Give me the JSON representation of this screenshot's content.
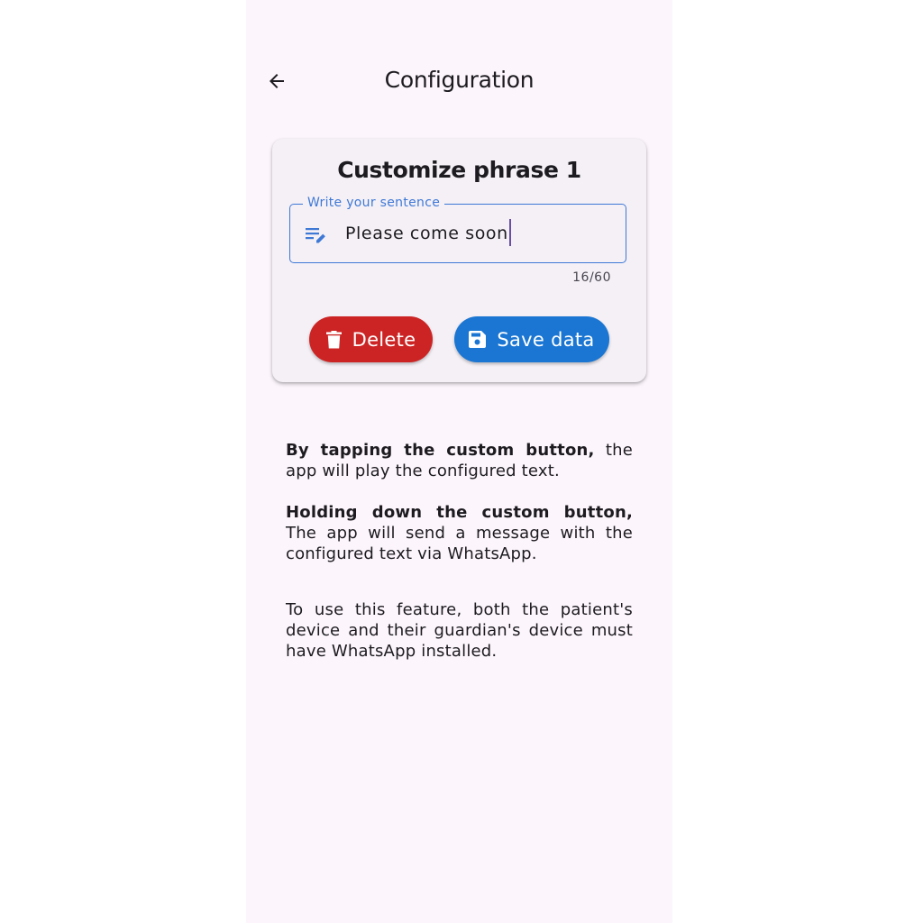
{
  "app_bar": {
    "title": "Configuration",
    "back_icon": "arrow-left-icon"
  },
  "card": {
    "title": "Customize phrase 1",
    "field": {
      "label": "Write your sentence",
      "icon": "edit-note-icon",
      "value": "Please come soon",
      "counter": "16/60"
    },
    "buttons": {
      "delete_label": "Delete",
      "delete_icon": "trash-icon",
      "delete_color": "#cc2424",
      "save_label": "Save data",
      "save_icon": "save-icon",
      "save_color": "#1a76d2"
    }
  },
  "info": {
    "tap_bold": "By tapping the custom button,",
    "tap_text": " the app will play the configured text.",
    "hold_bold": "Holding down the custom button,",
    "hold_text": " The app will send a message with the configured text via WhatsApp.",
    "requirement": "To use this feature, both the patient's device and their guardian's device must have WhatsApp installed."
  },
  "colors": {
    "background": "#fcf6fc",
    "card": "#f4f0f6",
    "accent": "#3f79d6",
    "caret": "#6750a4"
  }
}
